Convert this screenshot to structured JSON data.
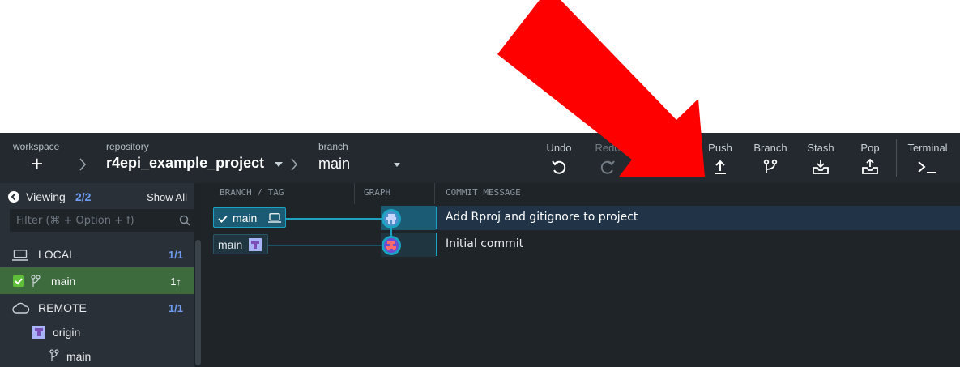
{
  "toolbar": {
    "workspace_label": "workspace",
    "workspace_add": "+",
    "repository_label": "repository",
    "repository_name": "r4epi_example_project",
    "branch_label": "branch",
    "branch_name": "main",
    "buttons": {
      "undo": "Undo",
      "redo": "Redo",
      "push": "Push",
      "branch": "Branch",
      "stash": "Stash",
      "pop": "Pop",
      "terminal": "Terminal"
    }
  },
  "sidebar": {
    "viewing_label": "Viewing",
    "viewing_count": "2/2",
    "show_all": "Show All",
    "filter_placeholder": "Filter (⌘ + Option + f)",
    "local": {
      "label": "LOCAL",
      "count": "1/1"
    },
    "local_branches": [
      {
        "name": "main",
        "status": "1↑"
      }
    ],
    "remote": {
      "label": "REMOTE",
      "count": "1/1"
    },
    "remotes": [
      {
        "name": "origin",
        "branches": [
          "main"
        ]
      }
    ]
  },
  "graph": {
    "headers": {
      "branch_tag": "BRANCH / TAG",
      "graph": "GRAPH",
      "commit_message": "COMMIT MESSAGE"
    },
    "commits": [
      {
        "branch": "main",
        "message": "Add Rproj and gitignore to project"
      },
      {
        "branch": "main",
        "message": "Initial commit"
      }
    ]
  },
  "colors": {
    "toolbar_bg": "#23292f",
    "panel_bg": "#2a3037",
    "graph_bg": "#1f2429",
    "accent_teal": "#1aa3c3",
    "selected_local": "#3d6b3d",
    "annotation_arrow": "#ff0000"
  }
}
